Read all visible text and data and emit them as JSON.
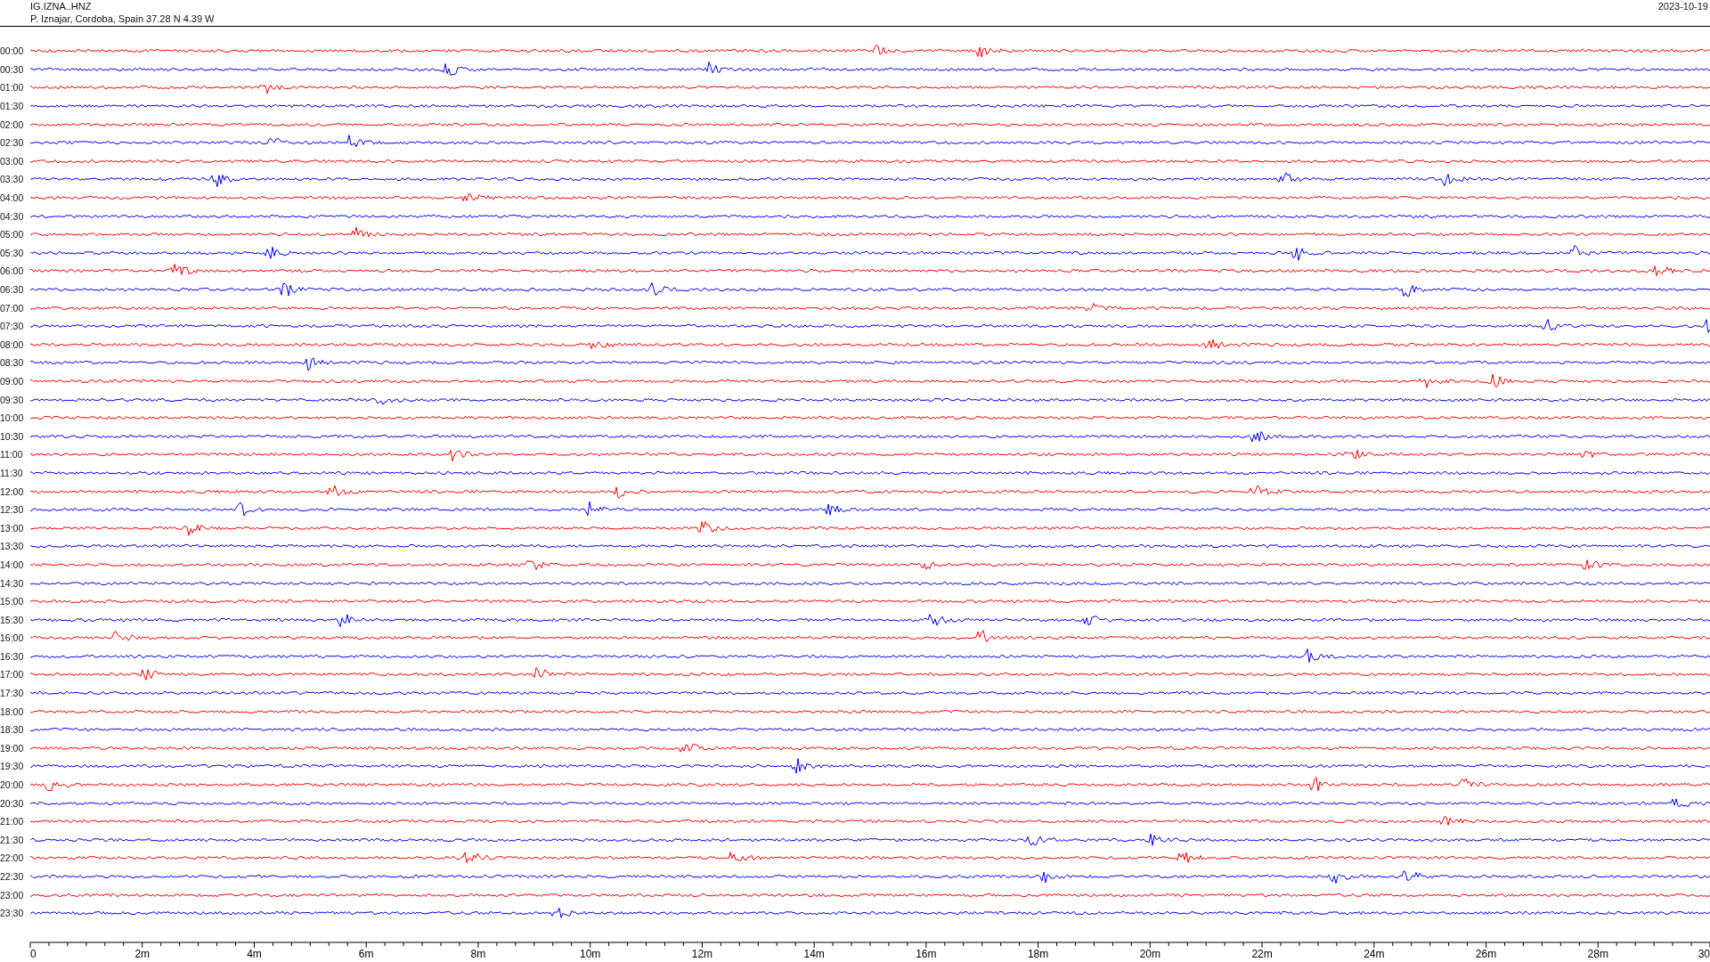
{
  "header": {
    "station": "IG.IZNA..HNZ",
    "location": "P. Iznajar, Cordoba, Spain  37.28 N 4.39 W",
    "date": "2023-10-19"
  },
  "rows": [
    {
      "time": "00:00",
      "color": "#ff0000"
    },
    {
      "time": "00:30",
      "color": "#0000ff"
    },
    {
      "time": "01:00",
      "color": "#ff0000"
    },
    {
      "time": "01:30",
      "color": "#0000ff"
    },
    {
      "time": "02:00",
      "color": "#ff0000"
    },
    {
      "time": "02:30",
      "color": "#0000ff"
    },
    {
      "time": "03:00",
      "color": "#ff0000"
    },
    {
      "time": "03:30",
      "color": "#0000ff"
    },
    {
      "time": "04:00",
      "color": "#ff0000"
    },
    {
      "time": "04:30",
      "color": "#0000ff"
    },
    {
      "time": "05:00",
      "color": "#ff0000"
    },
    {
      "time": "05:30",
      "color": "#0000ff"
    },
    {
      "time": "06:00",
      "color": "#ff0000"
    },
    {
      "time": "06:30",
      "color": "#0000ff"
    },
    {
      "time": "07:00",
      "color": "#ff0000"
    },
    {
      "time": "07:30",
      "color": "#0000ff"
    },
    {
      "time": "08:00",
      "color": "#ff0000"
    },
    {
      "time": "08:30",
      "color": "#0000ff"
    },
    {
      "time": "09:00",
      "color": "#ff0000"
    },
    {
      "time": "09:30",
      "color": "#0000ff"
    },
    {
      "time": "10:00",
      "color": "#ff0000"
    },
    {
      "time": "10:30",
      "color": "#0000ff"
    },
    {
      "time": "11:00",
      "color": "#ff0000"
    },
    {
      "time": "11:30",
      "color": "#0000ff"
    },
    {
      "time": "12:00",
      "color": "#ff0000"
    },
    {
      "time": "12:30",
      "color": "#0000ff"
    },
    {
      "time": "13:00",
      "color": "#ff0000"
    },
    {
      "time": "13:30",
      "color": "#0000ff"
    },
    {
      "time": "14:00",
      "color": "#ff0000"
    },
    {
      "time": "14:30",
      "color": "#0000ff"
    },
    {
      "time": "15:00",
      "color": "#ff0000"
    },
    {
      "time": "15:30",
      "color": "#0000ff"
    },
    {
      "time": "16:00",
      "color": "#ff0000"
    },
    {
      "time": "16:30",
      "color": "#0000ff"
    },
    {
      "time": "17:00",
      "color": "#ff0000"
    },
    {
      "time": "17:30",
      "color": "#0000ff"
    },
    {
      "time": "18:00",
      "color": "#ff0000"
    },
    {
      "time": "18:30",
      "color": "#0000ff"
    },
    {
      "time": "19:00",
      "color": "#ff0000"
    },
    {
      "time": "19:30",
      "color": "#0000ff"
    },
    {
      "time": "20:00",
      "color": "#ff0000"
    },
    {
      "time": "20:30",
      "color": "#0000ff"
    },
    {
      "time": "21:00",
      "color": "#ff0000"
    },
    {
      "time": "21:30",
      "color": "#0000ff"
    },
    {
      "time": "22:00",
      "color": "#ff0000"
    },
    {
      "time": "22:30",
      "color": "#0000ff"
    },
    {
      "time": "23:00",
      "color": "#ff0000"
    },
    {
      "time": "23:30",
      "color": "#0000ff"
    }
  ],
  "x_axis": {
    "labels": [
      "0",
      "2m",
      "4m",
      "6m",
      "8m",
      "10m",
      "12m",
      "14m",
      "16m",
      "18m",
      "20m",
      "22m",
      "24m",
      "26m",
      "28m",
      "30"
    ]
  }
}
